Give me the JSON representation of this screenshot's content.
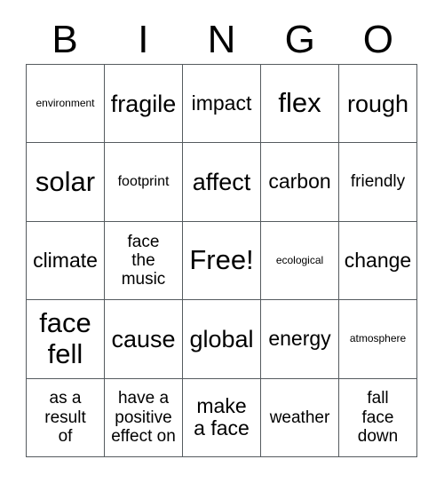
{
  "card": {
    "header_letters": [
      "B",
      "I",
      "N",
      "G",
      "O"
    ],
    "columns": 5,
    "rows": 5,
    "free_space_label": "Free!",
    "border_color": "#555b5f",
    "background_color": "#ffffff",
    "text_color": "#000000",
    "cells": [
      {
        "text": "environment",
        "size": "xs"
      },
      {
        "text": "fragile",
        "size": "xl"
      },
      {
        "text": "impact",
        "size": "lg"
      },
      {
        "text": "flex",
        "size": "xxl"
      },
      {
        "text": "rough",
        "size": "xl"
      },
      {
        "text": "solar",
        "size": "xxl"
      },
      {
        "text": "footprint",
        "size": "sm"
      },
      {
        "text": "affect",
        "size": "xl"
      },
      {
        "text": "carbon",
        "size": "lg"
      },
      {
        "text": "friendly",
        "size": "md"
      },
      {
        "text": "climate",
        "size": "lg"
      },
      {
        "text": "face\nthe\nmusic",
        "size": "md"
      },
      {
        "text": "Free!",
        "size": "xxl"
      },
      {
        "text": "ecological",
        "size": "xs"
      },
      {
        "text": "change",
        "size": "lg"
      },
      {
        "text": "face\nfell",
        "size": "xxl"
      },
      {
        "text": "cause",
        "size": "xl"
      },
      {
        "text": "global",
        "size": "xl"
      },
      {
        "text": "energy",
        "size": "lg"
      },
      {
        "text": "atmosphere",
        "size": "xs"
      },
      {
        "text": "as a\nresult\nof",
        "size": "md"
      },
      {
        "text": "have a\npositive\neffect on",
        "size": "md"
      },
      {
        "text": "make\na face",
        "size": "lg"
      },
      {
        "text": "weather",
        "size": "md"
      },
      {
        "text": "fall\nface\ndown",
        "size": "md"
      }
    ]
  }
}
